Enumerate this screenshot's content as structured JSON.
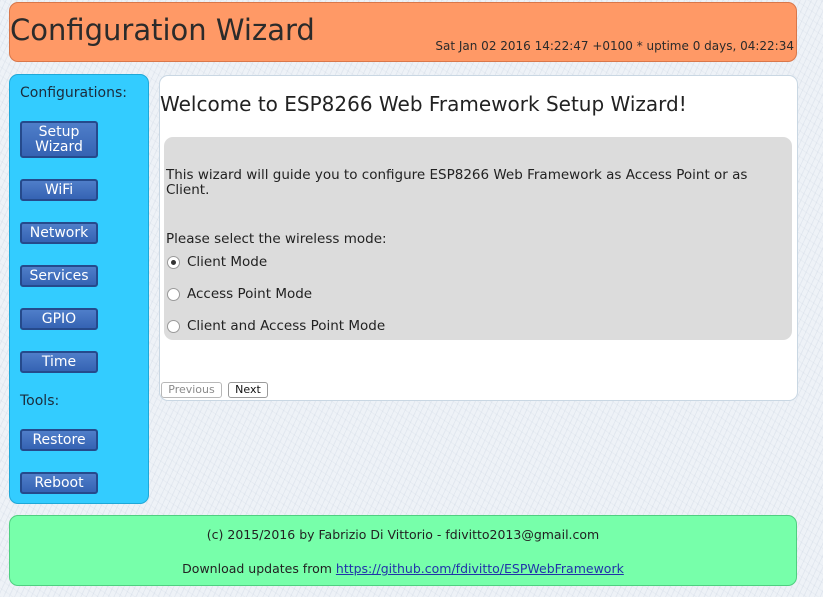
{
  "header": {
    "title": "Configuration Wizard",
    "status": "Sat Jan 02 2016 14:22:47 +0100 * uptime 0 days, 04:22:34"
  },
  "sidebar": {
    "configurations_heading": "Configurations:",
    "setup_wizard_line1": "Setup",
    "setup_wizard_line2": "Wizard",
    "wifi": "WiFi",
    "network": "Network",
    "services": "Services",
    "gpio": "GPIO",
    "time": "Time",
    "tools_heading": "Tools:",
    "restore": "Restore",
    "reboot": "Reboot"
  },
  "main": {
    "title": "Welcome to ESP8266 Web Framework Setup Wizard!",
    "intro": "This wizard will guide you to configure ESP8266 Web Framework as Access Point or as Client.",
    "prompt": "Please select the wireless mode:",
    "modes": [
      {
        "label": "Client Mode",
        "selected": true
      },
      {
        "label": "Access Point Mode",
        "selected": false
      },
      {
        "label": "Client and Access Point Mode",
        "selected": false
      }
    ],
    "previous_label": "Previous",
    "next_label": "Next"
  },
  "footer": {
    "credits": "(c) 2015/2016 by Fabrizio Di Vittorio - fdivitto2013@gmail.com",
    "download_prefix": "Download updates from",
    "download_link": "https://github.com/fdivitto/ESPWebFramework"
  },
  "colors": {
    "header_bg": "#ff9966",
    "sidebar_bg": "#33ccff",
    "footer_bg": "#77ffaa",
    "button_bg": "#3a6bbf"
  }
}
